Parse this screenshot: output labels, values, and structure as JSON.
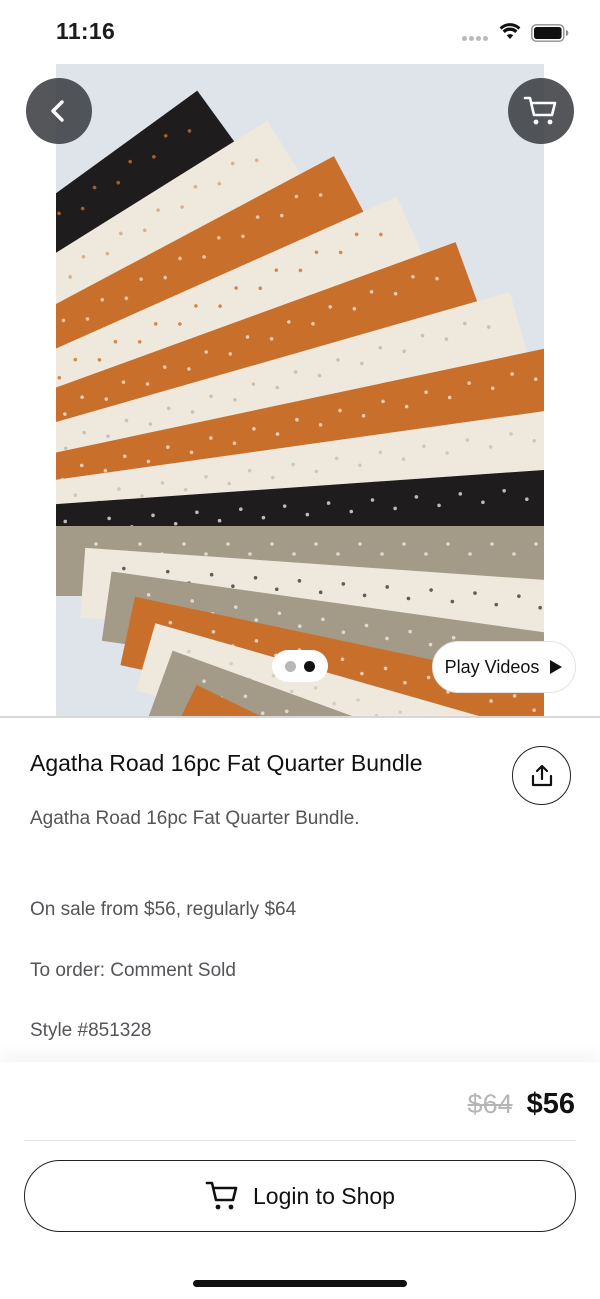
{
  "status_bar": {
    "time": "11:16",
    "icons": [
      "signal-dots-icon",
      "wifi-icon",
      "battery-icon"
    ]
  },
  "header": {
    "back_icon": "chevron-left-icon",
    "cart_icon": "cart-icon"
  },
  "gallery": {
    "image_description": "fan of orange, cream, black and taupe fat quarter fabrics",
    "pages": 2,
    "active_page": 2,
    "play_videos_label": "Play Videos",
    "play_icon": "play-icon"
  },
  "product": {
    "title": "Agatha Road 16pc Fat Quarter Bundle",
    "share_icon": "share-icon",
    "description": "Agatha Road 16pc Fat Quarter Bundle.",
    "sale_line": "On sale from $56, regularly $64",
    "order_line": "To order: Comment Sold",
    "style_line": "Style #851328"
  },
  "footer": {
    "regular_price": "$64",
    "sale_price": "$56",
    "cta_label": "Login to Shop",
    "cta_icon": "cart-icon"
  },
  "colors": {
    "fabric_orange": "#c96f2c",
    "fabric_cream": "#eee8dd",
    "fabric_black": "#1e1c1c",
    "fabric_taupe": "#a39a88",
    "overlay_button": "#3c3f42"
  }
}
